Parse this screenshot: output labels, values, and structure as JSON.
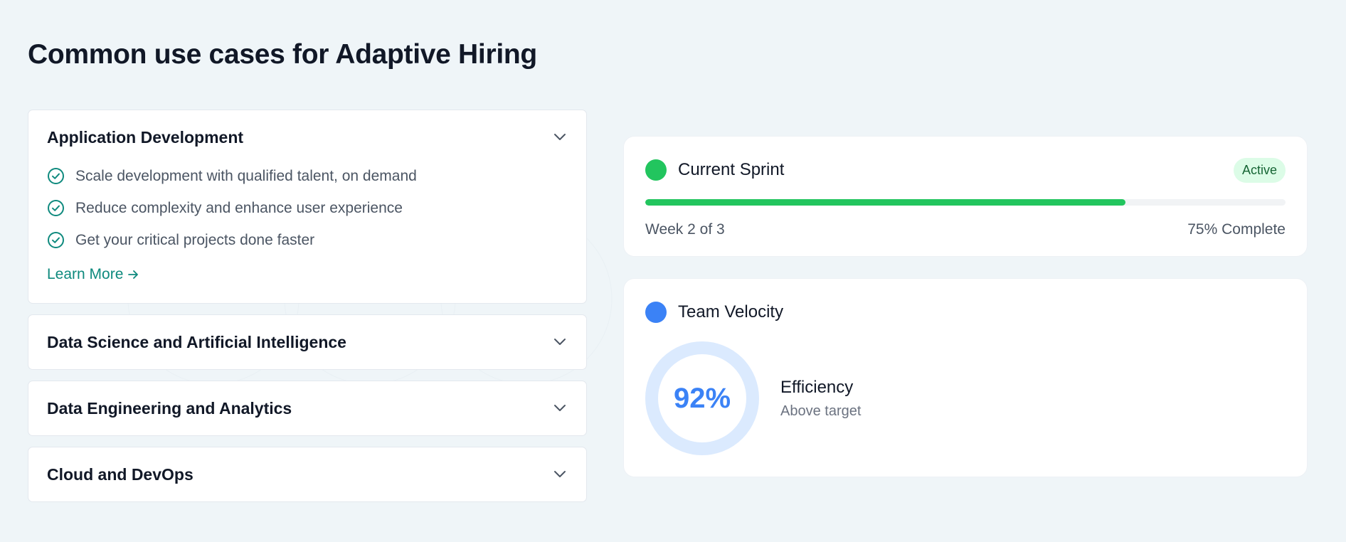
{
  "page": {
    "title": "Common use cases for Adaptive Hiring"
  },
  "accordion": {
    "items": [
      {
        "title": "Application Development",
        "expanded": true,
        "features": [
          "Scale development with qualified talent, on demand",
          "Reduce complexity and enhance user experience",
          "Get your critical projects done faster"
        ],
        "link_label": "Learn More"
      },
      {
        "title": "Data Science and Artificial Intelligence",
        "expanded": false
      },
      {
        "title": "Data Engineering and Analytics",
        "expanded": false
      },
      {
        "title": "Cloud and DevOps",
        "expanded": false
      }
    ]
  },
  "sprint": {
    "title": "Current Sprint",
    "status": "Active",
    "progress_percent": 75,
    "week_label": "Week 2 of 3",
    "complete_label": "75% Complete",
    "dot_color": "#22c55e"
  },
  "velocity": {
    "title": "Team Velocity",
    "value": "92%",
    "label": "Efficiency",
    "sublabel": "Above target",
    "dot_color": "#3b82f6"
  },
  "colors": {
    "accent_teal": "#0f8a7e",
    "progress_green": "#22c55e",
    "velocity_blue": "#3b82f6"
  }
}
